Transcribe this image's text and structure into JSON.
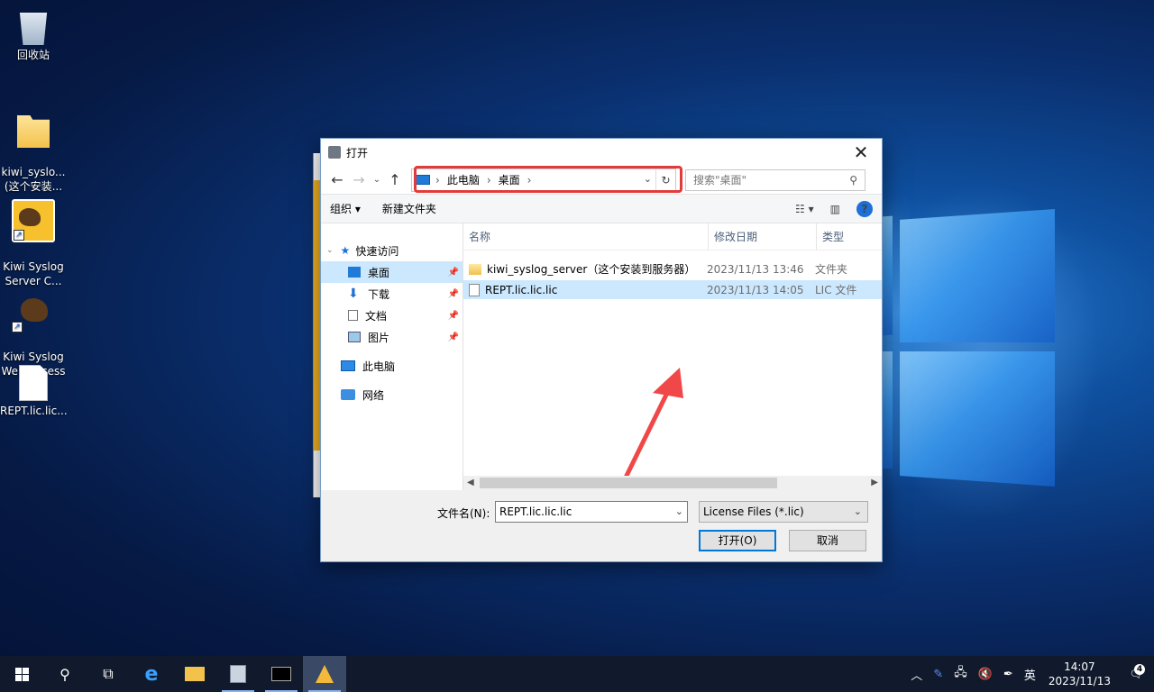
{
  "desktop": {
    "icons": [
      {
        "label": "回收站"
      },
      {
        "label": "kiwi_syslo...\n(这个安装..."
      },
      {
        "label": "Kiwi Syslog\nServer C..."
      },
      {
        "label": "Kiwi Syslog\nWeb Access"
      },
      {
        "label": "REPT.lic.lic..."
      }
    ]
  },
  "dialog": {
    "title": "打开",
    "address": {
      "crumbs": [
        "此电脑",
        "桌面"
      ]
    },
    "search_placeholder": "搜索\"桌面\"",
    "toolbar": {
      "organize": "组织 ▾",
      "new_folder": "新建文件夹"
    },
    "nav": {
      "quick_access": "快速访问",
      "items": [
        {
          "label": "桌面"
        },
        {
          "label": "下载"
        },
        {
          "label": "文档"
        },
        {
          "label": "图片"
        }
      ],
      "this_pc": "此电脑",
      "network": "网络"
    },
    "columns": {
      "name": "名称",
      "date": "修改日期",
      "type": "类型"
    },
    "files": [
      {
        "name": "kiwi_syslog_server（这个安装到服务器）",
        "date": "2023/11/13 13:46",
        "type": "文件夹"
      },
      {
        "name": "REPT.lic.lic.lic",
        "date": "2023/11/13 14:05",
        "type": "LIC 文件"
      }
    ],
    "filename_label": "文件名(N):",
    "filename_value": "REPT.lic.lic.lic",
    "filter_value": "License Files (*.lic)",
    "open_button": "打开(O)",
    "cancel_button": "取消"
  },
  "taskbar": {
    "ime": "英",
    "time": "14:07",
    "date": "2023/11/13",
    "notification_count": "4"
  }
}
